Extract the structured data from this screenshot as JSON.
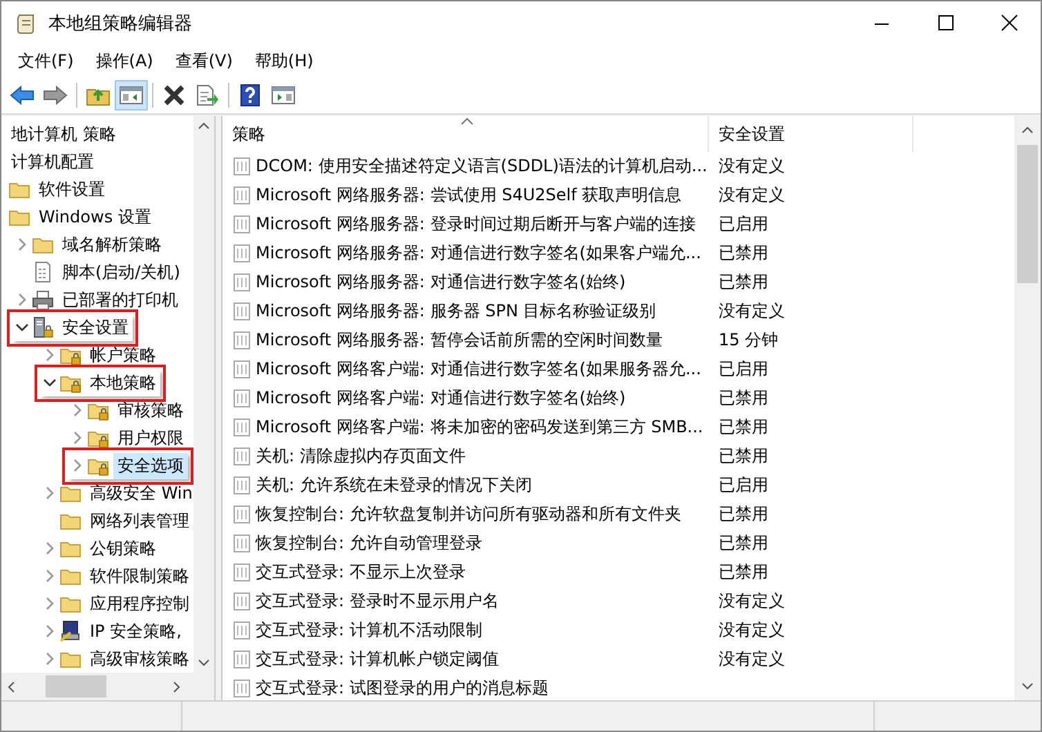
{
  "window": {
    "title": "本地组策略编辑器"
  },
  "menu": [
    "文件(F)",
    "操作(A)",
    "查看(V)",
    "帮助(H)"
  ],
  "toolbar": [
    {
      "kind": "back",
      "pressed": false
    },
    {
      "kind": "forward",
      "pressed": false
    },
    {
      "kind": "separator"
    },
    {
      "kind": "up",
      "pressed": false
    },
    {
      "kind": "console-tree",
      "pressed": true
    },
    {
      "kind": "separator"
    },
    {
      "kind": "delete",
      "pressed": false
    },
    {
      "kind": "export",
      "pressed": false
    },
    {
      "kind": "separator"
    },
    {
      "kind": "help",
      "pressed": false
    },
    {
      "kind": "action-pane",
      "pressed": false
    }
  ],
  "tree": [
    {
      "label": "地计算机 策略",
      "kind": "none",
      "selected": false,
      "highlighted": false,
      "children": [
        {
          "label": "计算机配置",
          "kind": "none",
          "selected": false,
          "highlighted": false,
          "children": [
            {
              "label": "软件设置",
              "kind": "folder",
              "selected": false,
              "highlighted": false
            },
            {
              "label": "Windows 设置",
              "kind": "folder",
              "selected": false,
              "highlighted": false,
              "children": [
                {
                  "label": "域名解析策略",
                  "kind": "folder",
                  "expanded": false,
                  "selected": false,
                  "highlighted": false
                },
                {
                  "label": "脚本(启动/关机)",
                  "kind": "script",
                  "selected": false,
                  "highlighted": false
                },
                {
                  "label": "已部署的打印机",
                  "kind": "printer",
                  "expanded": false,
                  "selected": false,
                  "highlighted": false
                },
                {
                  "label": "安全设置",
                  "kind": "security",
                  "expanded": true,
                  "selected": false,
                  "highlighted": true,
                  "children": [
                    {
                      "label": "帐户策略",
                      "kind": "lock-folder",
                      "expanded": false,
                      "selected": false,
                      "highlighted": false
                    },
                    {
                      "label": "本地策略",
                      "kind": "lock-folder",
                      "expanded": true,
                      "selected": false,
                      "highlighted": true,
                      "children": [
                        {
                          "label": "审核策略",
                          "kind": "lock-folder",
                          "expanded": false,
                          "selected": false,
                          "highlighted": false
                        },
                        {
                          "label": "用户权限",
                          "kind": "lock-folder",
                          "expanded": false,
                          "selected": false,
                          "highlighted": false
                        },
                        {
                          "label": "安全选项",
                          "kind": "lock-folder",
                          "expanded": false,
                          "selected": true,
                          "highlighted": true
                        }
                      ]
                    },
                    {
                      "label": "高级安全 Win",
                      "kind": "folder",
                      "expanded": false,
                      "selected": false,
                      "highlighted": false
                    },
                    {
                      "label": "网络列表管理",
                      "kind": "folder",
                      "selected": false,
                      "highlighted": false
                    },
                    {
                      "label": "公钥策略",
                      "kind": "folder",
                      "expanded": false,
                      "selected": false,
                      "highlighted": false
                    },
                    {
                      "label": "软件限制策略",
                      "kind": "folder",
                      "expanded": false,
                      "selected": false,
                      "highlighted": false
                    },
                    {
                      "label": "应用程序控制",
                      "kind": "folder",
                      "expanded": false,
                      "selected": false,
                      "highlighted": false
                    },
                    {
                      "label": "IP 安全策略,",
                      "kind": "ip-security",
                      "expanded": false,
                      "selected": false,
                      "highlighted": false
                    },
                    {
                      "label": "高级审核策略",
                      "kind": "folder",
                      "expanded": false,
                      "selected": false,
                      "highlighted": false
                    }
                  ]
                }
              ]
            }
          ]
        }
      ]
    }
  ],
  "table": {
    "columns": [
      "策略",
      "安全设置"
    ],
    "rows": [
      {
        "policy": "DCOM: 使用安全描述符定义语言(SDDL)语法的计算机启动...",
        "setting": "没有定义"
      },
      {
        "policy": "Microsoft 网络服务器: 尝试使用 S4U2Self 获取声明信息",
        "setting": "没有定义"
      },
      {
        "policy": "Microsoft 网络服务器: 登录时间过期后断开与客户端的连接",
        "setting": "已启用"
      },
      {
        "policy": "Microsoft 网络服务器: 对通信进行数字签名(如果客户端允...",
        "setting": "已禁用"
      },
      {
        "policy": "Microsoft 网络服务器: 对通信进行数字签名(始终)",
        "setting": "已禁用"
      },
      {
        "policy": "Microsoft 网络服务器: 服务器 SPN 目标名称验证级别",
        "setting": "没有定义"
      },
      {
        "policy": "Microsoft 网络服务器: 暂停会话前所需的空闲时间数量",
        "setting": "15 分钟"
      },
      {
        "policy": "Microsoft 网络客户端: 对通信进行数字签名(如果服务器允...",
        "setting": "已启用"
      },
      {
        "policy": "Microsoft 网络客户端: 对通信进行数字签名(始终)",
        "setting": "已禁用"
      },
      {
        "policy": "Microsoft 网络客户端: 将未加密的密码发送到第三方 SMB...",
        "setting": "已禁用"
      },
      {
        "policy": "关机: 清除虚拟内存页面文件",
        "setting": "已禁用"
      },
      {
        "policy": "关机: 允许系统在未登录的情况下关闭",
        "setting": "已启用"
      },
      {
        "policy": "恢复控制台: 允许软盘复制并访问所有驱动器和所有文件夹",
        "setting": "已禁用"
      },
      {
        "policy": "恢复控制台: 允许自动管理登录",
        "setting": "已禁用"
      },
      {
        "policy": "交互式登录: 不显示上次登录",
        "setting": "已禁用"
      },
      {
        "policy": "交互式登录: 登录时不显示用户名",
        "setting": "没有定义"
      },
      {
        "policy": "交互式登录: 计算机不活动限制",
        "setting": "没有定义"
      },
      {
        "policy": "交互式登录: 计算机帐户锁定阈值",
        "setting": "没有定义"
      },
      {
        "policy": "交互式登录: 试图登录的用户的消息标题"
      }
    ]
  }
}
